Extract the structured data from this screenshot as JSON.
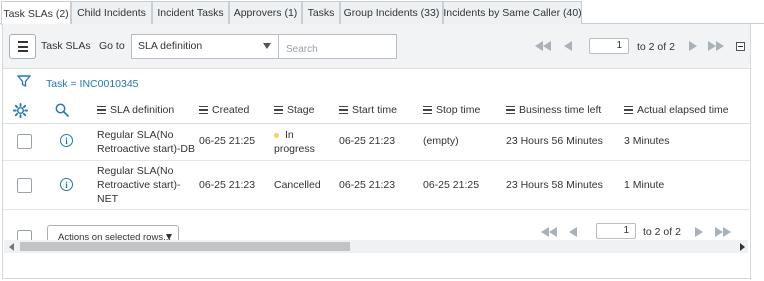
{
  "tabs": [
    {
      "label": "Task SLAs (2)",
      "active": true
    },
    {
      "label": "Child Incidents"
    },
    {
      "label": "Incident Tasks"
    },
    {
      "label": "Approvers (1)"
    },
    {
      "label": "Tasks"
    },
    {
      "label": "Group Incidents (33)"
    },
    {
      "label": "Incidents by Same Caller (40)"
    }
  ],
  "toolbar": {
    "title": "Task SLAs",
    "goto_label": "Go to",
    "goto_selected": "SLA definition",
    "search_placeholder": "Search",
    "page_value": "1",
    "page_text": "to 2 of 2"
  },
  "filter": {
    "text": "Task = INC0010345"
  },
  "columns": [
    "SLA definition",
    "Created",
    "Stage",
    "Start time",
    "Stop time",
    "Business time left",
    "Actual elapsed time"
  ],
  "rows": [
    {
      "sla_line1": "Regular SLA(No",
      "sla_line2": "Retroactive start)-DB",
      "created": "06-25 21:25",
      "stage_line1": "In",
      "stage_line2": "progress",
      "start": "06-25 21:23",
      "stop": "(empty)",
      "business_left": "23 Hours 56 Minutes",
      "elapsed": "3 Minutes"
    },
    {
      "sla_line1": "Regular SLA(No",
      "sla_line2": "Retroactive start)-",
      "sla_line3": "NET",
      "created": "06-25 21:23",
      "stage": "Cancelled",
      "start": "06-25 21:23",
      "stop": "06-25 21:25",
      "business_left": "23 Hours 58 Minutes",
      "elapsed": "1 Minute"
    }
  ],
  "footer": {
    "actions_label": "Actions on selected rows...",
    "page_value": "1",
    "page_text": "to 2 of 2"
  },
  "colors": {
    "accent": "#1f77bb",
    "in_progress_dot": "#f4d35e"
  }
}
